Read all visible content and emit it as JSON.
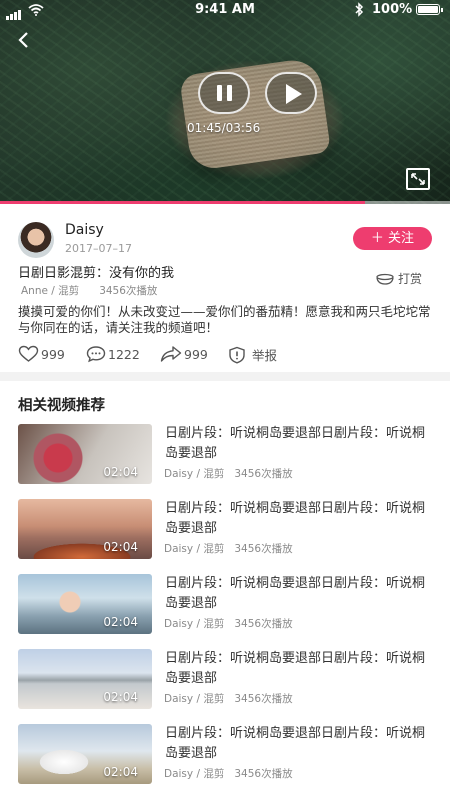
{
  "status_bar": {
    "time": "9:41 AM",
    "battery": "100%"
  },
  "player": {
    "time_display": "01:45/03:56",
    "progress": 0.81,
    "accent_color": "#ee3d6f"
  },
  "author": {
    "name": "Daisy",
    "date": "2017–07–17",
    "follow_label": "＋ 关注"
  },
  "video": {
    "title": "日剧日影混剪：没有你的我",
    "meta": "Anne / 混剪      3456次播放",
    "tip_label": "打赏",
    "description": "摸摸可爱的你们！从未改变过——爱你们的番茄精！愿意我和两只毛坨坨常与你同在的话，请关注我的频道吧！",
    "likes": "999",
    "comments": "1222",
    "shares": "999",
    "report_label": "举报"
  },
  "related": {
    "section_title": "相关视频推荐",
    "items": [
      {
        "title": "日剧片段：听说桐岛要退部日剧片段：听说桐岛要退部",
        "meta": "Daisy / 混剪   3456次播放",
        "duration": "02:04"
      },
      {
        "title": "日剧片段：听说桐岛要退部日剧片段：听说桐岛要退部",
        "meta": "Daisy / 混剪   3456次播放",
        "duration": "02:04"
      },
      {
        "title": "日剧片段：听说桐岛要退部日剧片段：听说桐岛要退部",
        "meta": "Daisy / 混剪   3456次播放",
        "duration": "02:04"
      },
      {
        "title": "日剧片段：听说桐岛要退部日剧片段：听说桐岛要退部",
        "meta": "Daisy / 混剪   3456次播放",
        "duration": "02:04"
      },
      {
        "title": "日剧片段：听说桐岛要退部日剧片段：听说桐岛要退部",
        "meta": "Daisy / 混剪   3456次播放",
        "duration": "02:04"
      }
    ]
  },
  "icons": [
    "signal-icon",
    "wifi-icon",
    "bluetooth-icon",
    "battery-icon",
    "back-arrow-icon",
    "pause-icon",
    "play-icon",
    "fullscreen-icon",
    "tip-bowl-icon",
    "heart-icon",
    "comment-icon",
    "share-icon",
    "report-shield-icon"
  ]
}
